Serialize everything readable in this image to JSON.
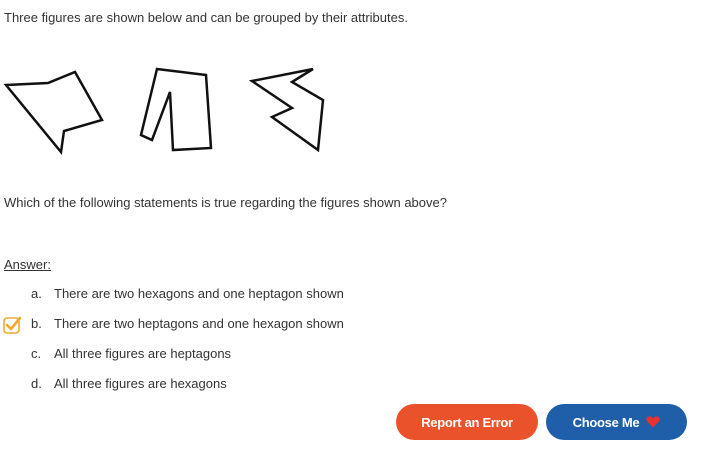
{
  "question": {
    "intro": "Three figures are shown below and can be grouped by their attributes.",
    "prompt": "Which of the following statements is true regarding the figures shown above?"
  },
  "answer": {
    "heading": "Answer:",
    "options": [
      {
        "letter": "a.",
        "text": "There are two hexagons and one heptagon shown",
        "selected": false
      },
      {
        "letter": "b.",
        "text": "There are two heptagons and one hexagon shown",
        "selected": true
      },
      {
        "letter": "c.",
        "text": "All three figures are heptagons",
        "selected": false
      },
      {
        "letter": "d.",
        "text": "All three figures are hexagons",
        "selected": false
      }
    ]
  },
  "actions": {
    "report_label": "Report an Error",
    "choose_label": "Choose Me"
  },
  "colors": {
    "report_button": "#e9522a",
    "choose_button": "#1f5ea8",
    "heart": "#e8322f",
    "check": "#f0a830"
  },
  "icons": [
    "checkmark-checkbox-icon",
    "heart-icon"
  ]
}
